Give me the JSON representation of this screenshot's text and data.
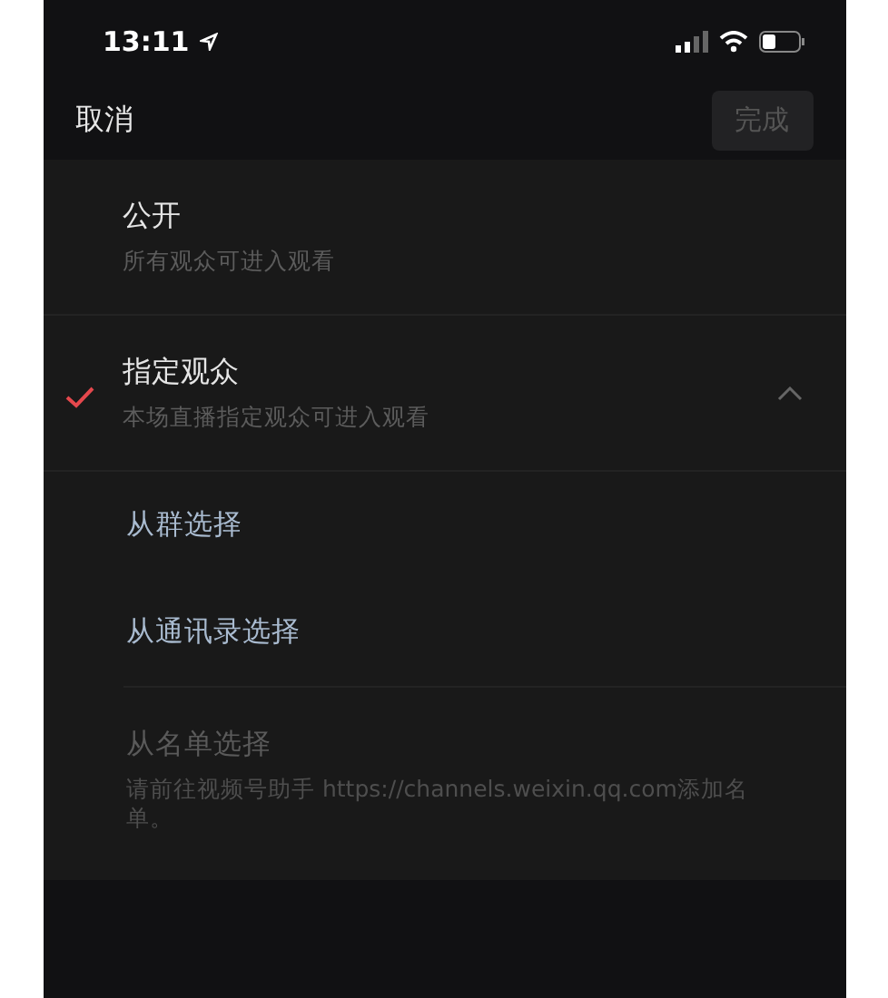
{
  "status_bar": {
    "time": "13:11"
  },
  "nav": {
    "cancel": "取消",
    "done": {
      "label": "完成",
      "disabled": true
    }
  },
  "options": [
    {
      "title": "公开",
      "subtitle": "所有观众可进入观看",
      "selected": false
    },
    {
      "title": "指定观众",
      "subtitle": "本场直播指定观众可进入观看",
      "selected": true,
      "expanded": true,
      "children": [
        {
          "label": "从群选择",
          "disabled": false
        },
        {
          "label": "从通讯录选择",
          "disabled": false
        },
        {
          "label": "从名单选择",
          "description": "请前往视频号助手 https://channels.weixin.qq.com添加名单。",
          "disabled": true
        }
      ]
    }
  ]
}
